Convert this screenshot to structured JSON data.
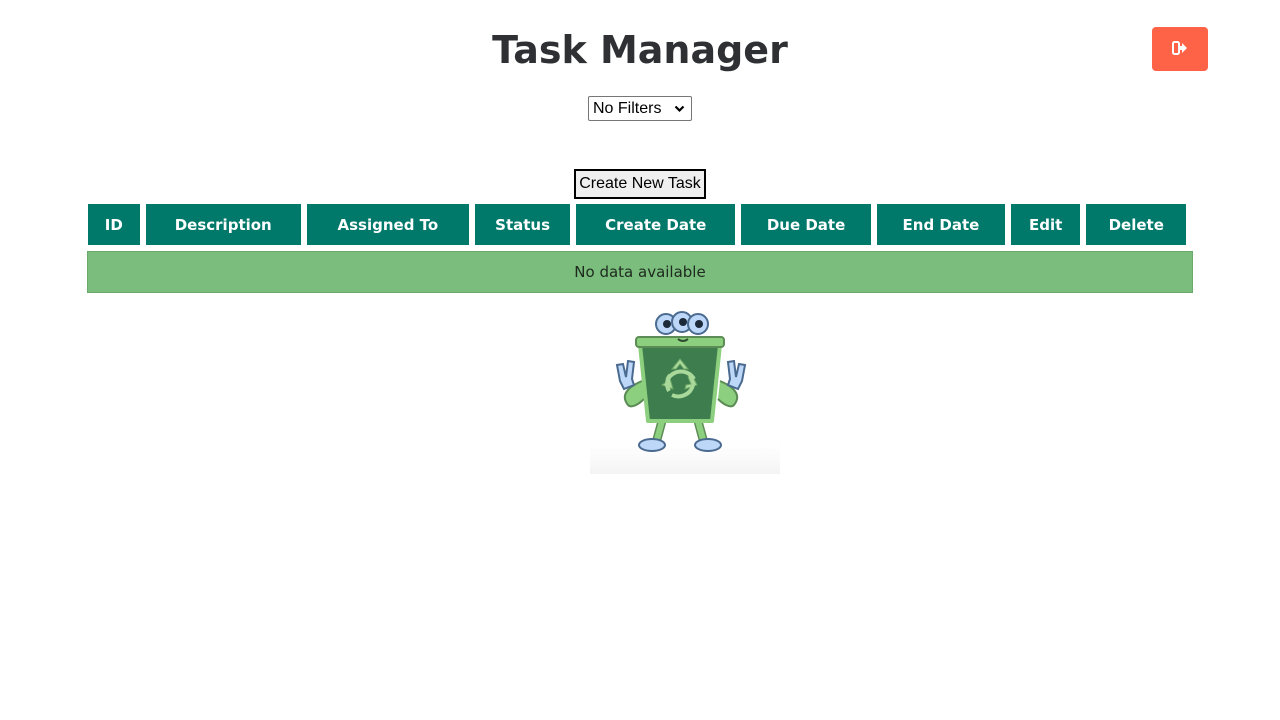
{
  "header": {
    "title": "Task Manager",
    "logout_icon": "sign-out-icon",
    "logout_color": "#ff6347"
  },
  "filters": {
    "selected": "No Filters"
  },
  "toolbar": {
    "create_label": "Create New Task"
  },
  "table": {
    "header_color": "#00796b",
    "columns": [
      "ID",
      "Description",
      "Assigned To",
      "Status",
      "Create Date",
      "Due Date",
      "End Date",
      "Edit",
      "Delete"
    ],
    "empty_message": "No data available",
    "empty_color": "#7bbd7d"
  },
  "illustration": {
    "icon": "recycle-bin-mascot"
  }
}
